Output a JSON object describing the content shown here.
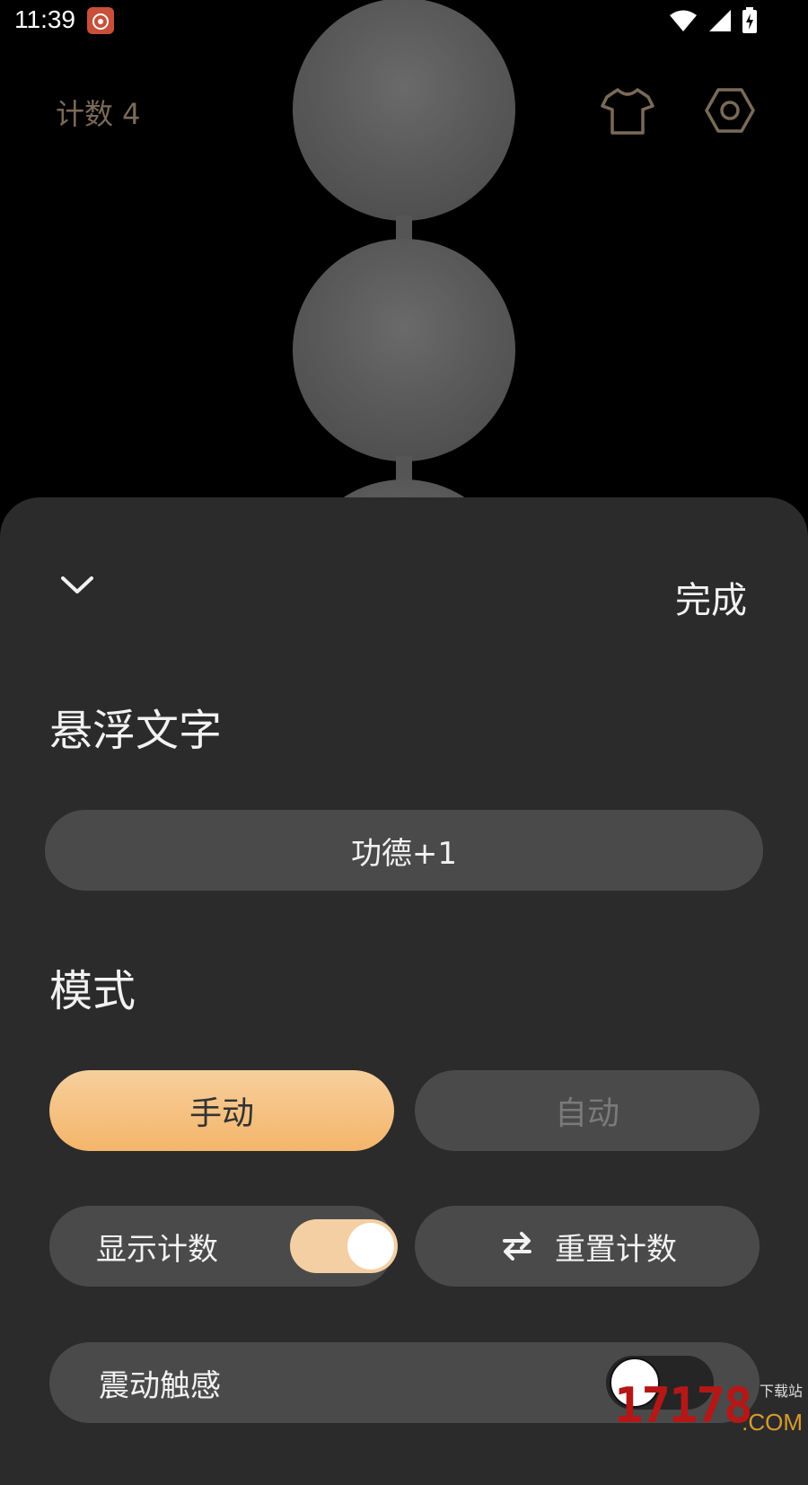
{
  "status_bar": {
    "time": "11:39",
    "app_icon": "weibo-app-icon",
    "wifi_icon": "wifi-icon",
    "signal_icon": "signal-icon",
    "battery_icon": "battery-charging-icon"
  },
  "header": {
    "counter_label": "计数 4",
    "shirt_icon": "shirt-icon",
    "settings_icon": "gear-icon"
  },
  "sheet": {
    "collapse_icon": "chevron-down-icon",
    "done_label": "完成",
    "floating_text_title": "悬浮文字",
    "floating_text_value": "功德+1",
    "mode_title": "模式",
    "mode_manual_label": "手动",
    "mode_auto_label": "自动",
    "show_count_label": "显示计数",
    "show_count_enabled": true,
    "reset_icon": "swap-arrows-icon",
    "reset_count_label": "重置计数",
    "vibration_label": "震动触感",
    "vibration_enabled": false
  },
  "watermark": {
    "main": "17178",
    "domain": ".COM",
    "cn": "下载站"
  },
  "colors": {
    "accent": "#f3b56a",
    "sheet_bg": "#2b2b2b",
    "pill_bg": "#4a4a4a"
  }
}
